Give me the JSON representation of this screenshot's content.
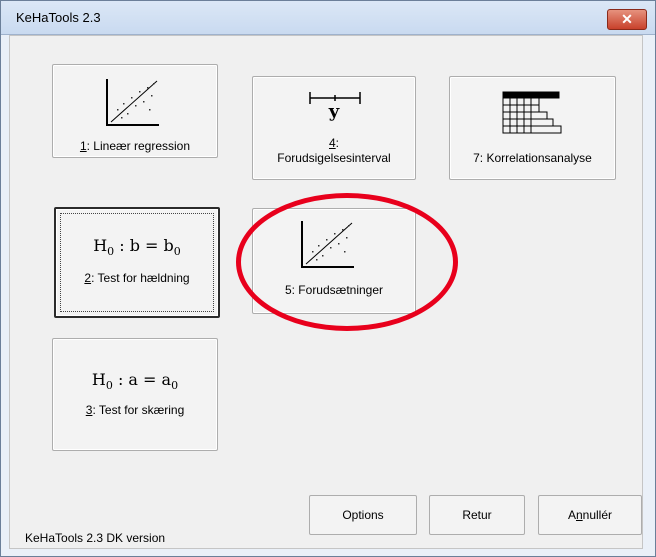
{
  "window": {
    "title": "KeHaTools 2.3",
    "close_label": "✕"
  },
  "tools": {
    "linear_regression": {
      "mnemonic": "1",
      "label": ": Lineær regression"
    },
    "prediction_interval": {
      "symbol": "y",
      "mnemonic": "4",
      "label_suffix": ":",
      "label_line2": "Forudsigelsesinterval"
    },
    "correlation_analysis": {
      "label": "7: Korrelationsanalyse"
    },
    "slope_test": {
      "formula_lhs": "H",
      "formula_sub": "0",
      "formula_mid": " : b = b",
      "formula_sub2": "0",
      "mnemonic": "2",
      "label": ": Test for hældning"
    },
    "assumptions": {
      "label": "5: Forudsætninger"
    },
    "intercept_test": {
      "formula_lhs": "H",
      "formula_sub": "0",
      "formula_mid": " : a = a",
      "formula_sub2": "0",
      "mnemonic": "3",
      "label": ": Test for skæring"
    }
  },
  "buttons": {
    "options": "Options",
    "retur": "Retur",
    "annuller_pre": "A",
    "annuller_mnemonic": "n",
    "annuller_post": "nullér"
  },
  "footer": {
    "version_text": "KeHaTools 2.3  DK version"
  },
  "annotation": {
    "highlight_color": "#e8001c"
  }
}
